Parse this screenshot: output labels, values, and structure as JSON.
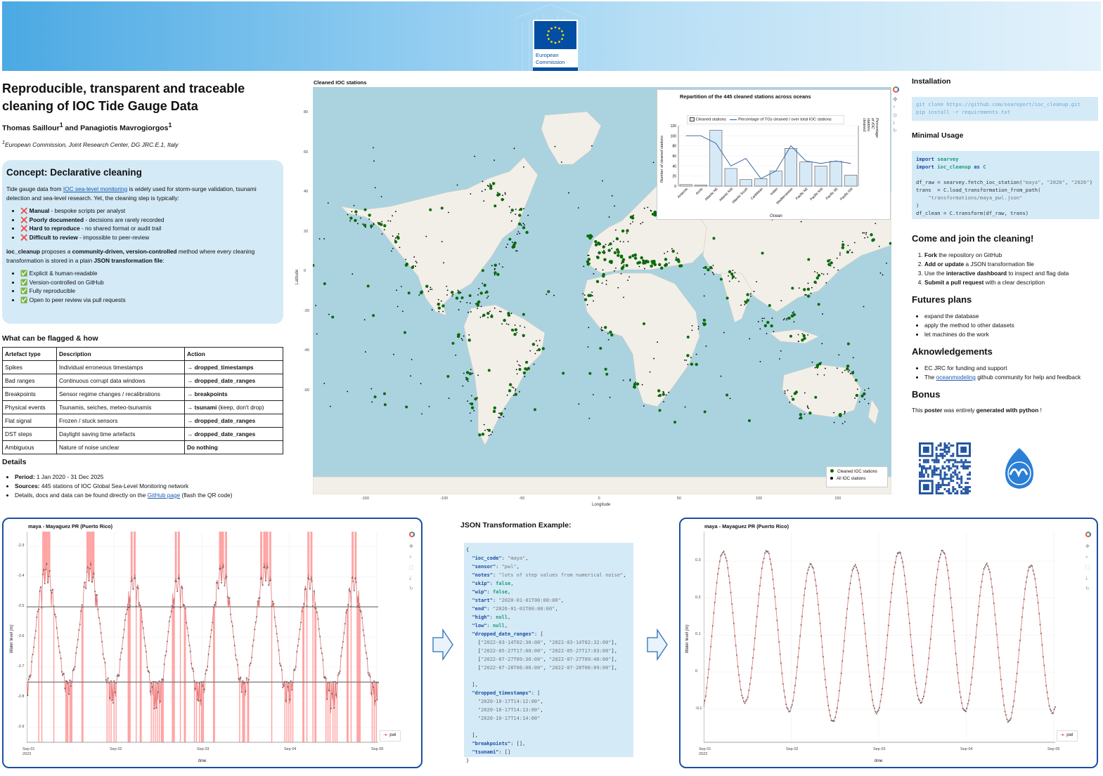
{
  "banner": {
    "org_line1": "European",
    "org_line2": "Commission"
  },
  "title": "Reproducible, transparent and traceable cleaning of IOC Tide Gauge Data",
  "authors": {
    "a1": "Thomas Saillour",
    "sup1": "1",
    "and": " and ",
    "a2": "Panagiotis Mavrogiorgos",
    "sup2": "1"
  },
  "affiliation": {
    "sup": "1",
    "text": "European Commission, Joint Research Center, DG JRC.E.1, Italy"
  },
  "concept": {
    "heading": "Concept: Declarative cleaning",
    "p1_a": "Tide gauge data from ",
    "p1_link": "IOC sea-level monitoring",
    "p1_b": " is widely used for storm-surge validation, tsunami detection and sea-level research. Yet, the cleaning step is typically:",
    "problems": [
      {
        "icon": "❌",
        "bold": "Manual",
        "rest": " - bespoke scripts per analyst"
      },
      {
        "icon": "❌",
        "bold": "Poorly documented",
        "rest": " - decisions are rarely recorded"
      },
      {
        "icon": "❌",
        "bold": "Hard to reproduce",
        "rest": " - no shared format or audit trail"
      },
      {
        "icon": "❌",
        "bold": "Difficult to review",
        "rest": " - impossible to peer-review"
      }
    ],
    "p2_a": "ioc_cleanup",
    "p2_b": " proposes a ",
    "p2_c": "community-driven, version-controlled",
    "p2_d": " method where every cleaning transformation is stored in a plain ",
    "p2_e": "JSON transformation file",
    "p2_f": ":",
    "benefits": [
      {
        "icon": "✅",
        "text": "Explicit & human-readable"
      },
      {
        "icon": "✅",
        "text": "Version-controlled on GitHub"
      },
      {
        "icon": "✅",
        "text": "Fully reproducible"
      },
      {
        "icon": "✅",
        "text": "Open to peer review via pull requests"
      }
    ]
  },
  "flag_table": {
    "heading": "What can be flagged & how",
    "headers": [
      "Artefact type",
      "Description",
      "Action"
    ],
    "rows": [
      {
        "type": "Spikes",
        "desc": "Individual erroneous timestamps",
        "arrow": "→ ",
        "action": "dropped_timestamps",
        "extra": ""
      },
      {
        "type": "Bad ranges",
        "desc": "Continuous corrupt data windows",
        "arrow": "→ ",
        "action": "dropped_date_ranges",
        "extra": ""
      },
      {
        "type": "Breakpoints",
        "desc": "Sensor regime changes / recalibrations",
        "arrow": "→ ",
        "action": "breakpoints",
        "extra": ""
      },
      {
        "type": "Physical events",
        "desc": "Tsunamis, seiches, meteo-tsunamis",
        "arrow": "→ ",
        "action": "tsunami",
        "extra": " (keep, don't drop)"
      },
      {
        "type": "Flat signal",
        "desc": "Frozen / stuck sensors",
        "arrow": "→ ",
        "action": "dropped_date_ranges",
        "extra": ""
      },
      {
        "type": "DST steps",
        "desc": "Daylight saving time artefacts",
        "arrow": "→ ",
        "action": "dropped_date_ranges",
        "extra": ""
      },
      {
        "type": "Ambiguous",
        "desc": "Nature of noise unclear",
        "arrow": "",
        "action": "Do nothing",
        "extra": ""
      }
    ]
  },
  "details": {
    "heading": "Details",
    "period_label": "Period:",
    "period": " 1 Jan 2020 - 31 Dec 2025",
    "sources_label": "Sources:",
    "sources": " 445 stations of IOC Global Sea-Level Monitoring network",
    "docs_a": "Details, docs and data can be found directly on the ",
    "docs_link": "GitHub page",
    "docs_b": " (flash the QR code)"
  },
  "map": {
    "title": "Cleaned IOC stations",
    "xlabel": "Longitude",
    "ylabel": "Latitude",
    "yticks": [
      "80",
      "60",
      "40",
      "20",
      "0",
      "-20",
      "-40",
      "-60"
    ],
    "xticks": [
      "-150",
      "-100",
      "-50",
      "0",
      "50",
      "100",
      "150"
    ],
    "legend": [
      "Cleaned IOC stations",
      "All IOC stations"
    ],
    "colors": {
      "cleaned": "#0a6b0a",
      "all": "#000000",
      "ocean": "#aad3df",
      "land": "#f2efe9"
    }
  },
  "chart_data": {
    "type": "bar",
    "title": "Repartition of the 445 cleaned stations across oceans",
    "xlabel": "Ocean",
    "ylabel": "Number of cleaned stations",
    "y2label": "Percentage of IOC stations cleaned",
    "categories": [
      "Antarctic",
      "Arctic",
      "Atlantic NE",
      "Atlantic NW",
      "Atlantic South",
      "Caribbean",
      "Indian",
      "Mediterranean",
      "Pacific NE",
      "Pacific NW",
      "Pacific SE",
      "Pacific SW"
    ],
    "series": [
      {
        "name": "Cleaned stations",
        "values": [
          3,
          2,
          111,
          35,
          13,
          15,
          30,
          75,
          48,
          40,
          49,
          22
        ]
      },
      {
        "name": "Percentage of TGs cleaned / over total IOC stations",
        "values": [
          100,
          100,
          85,
          40,
          55,
          15,
          30,
          80,
          50,
          45,
          50,
          45
        ]
      }
    ],
    "ylim": [
      0,
      120
    ],
    "yticks": [
      "0",
      "20",
      "40",
      "60",
      "80",
      "100",
      "120"
    ]
  },
  "installation": {
    "heading": "Installation",
    "code": "git clone https://github.com/seareport/ioc_cleanup.git\npip install -r requirements.txt"
  },
  "usage": {
    "heading": "Minimal Usage"
  },
  "join": {
    "heading": "Come and join the cleaning!",
    "steps": [
      {
        "bold": "Fork",
        "rest": " the repository on GitHub",
        "pre": ""
      },
      {
        "bold": "Add or update",
        "rest": " a JSON transformation file",
        "pre": ""
      },
      {
        "pre": "Use the ",
        "bold": "interactive dashboard",
        "rest": " to inspect and flag data"
      },
      {
        "bold": "Submit a pull request",
        "rest": " with a clear description",
        "pre": ""
      }
    ]
  },
  "futures": {
    "heading": "Futures plans",
    "items": [
      "expand the database",
      "apply the method to other datasets",
      "let machines do the work"
    ]
  },
  "ack": {
    "heading": "Aknowledgements",
    "item1": "EC JRC for funding and support",
    "item2_a": "The ",
    "item2_link": "oceanmodeling",
    "item2_b": " github community for help and feedback"
  },
  "bonus": {
    "heading": "Bonus",
    "a": "This ",
    "b": "poster",
    "c": " was entirely ",
    "d": "generated with python",
    "e": " !"
  },
  "left_plot": {
    "title": "maya - Mayaguez PR (Puerto Rico)",
    "ylabel": "Water level (m)",
    "xlabel": "time",
    "yticks": [
      "-2.3",
      "-2.4",
      "-2.5",
      "-2.6",
      "-2.7",
      "-2.8",
      "-2.9"
    ],
    "xticks": [
      "Sep 01",
      "Sep 02",
      "Sep 03",
      "Sep 04",
      "Sep 05"
    ],
    "year": "2023",
    "legend": "pwl"
  },
  "right_plot": {
    "title": "maya - Mayaguez PR (Puerto Rico)",
    "ylabel": "Water level (m)",
    "xlabel": "time",
    "yticks": [
      "0.3",
      "0.2",
      "0.1",
      "0",
      "-0.1"
    ],
    "xticks": [
      "Sep 01",
      "Sep 02",
      "Sep 03",
      "Sep 04",
      "Sep 05"
    ],
    "year": "2023",
    "legend": "pwl"
  },
  "json_example": {
    "heading": "JSON Transformation Example:"
  }
}
